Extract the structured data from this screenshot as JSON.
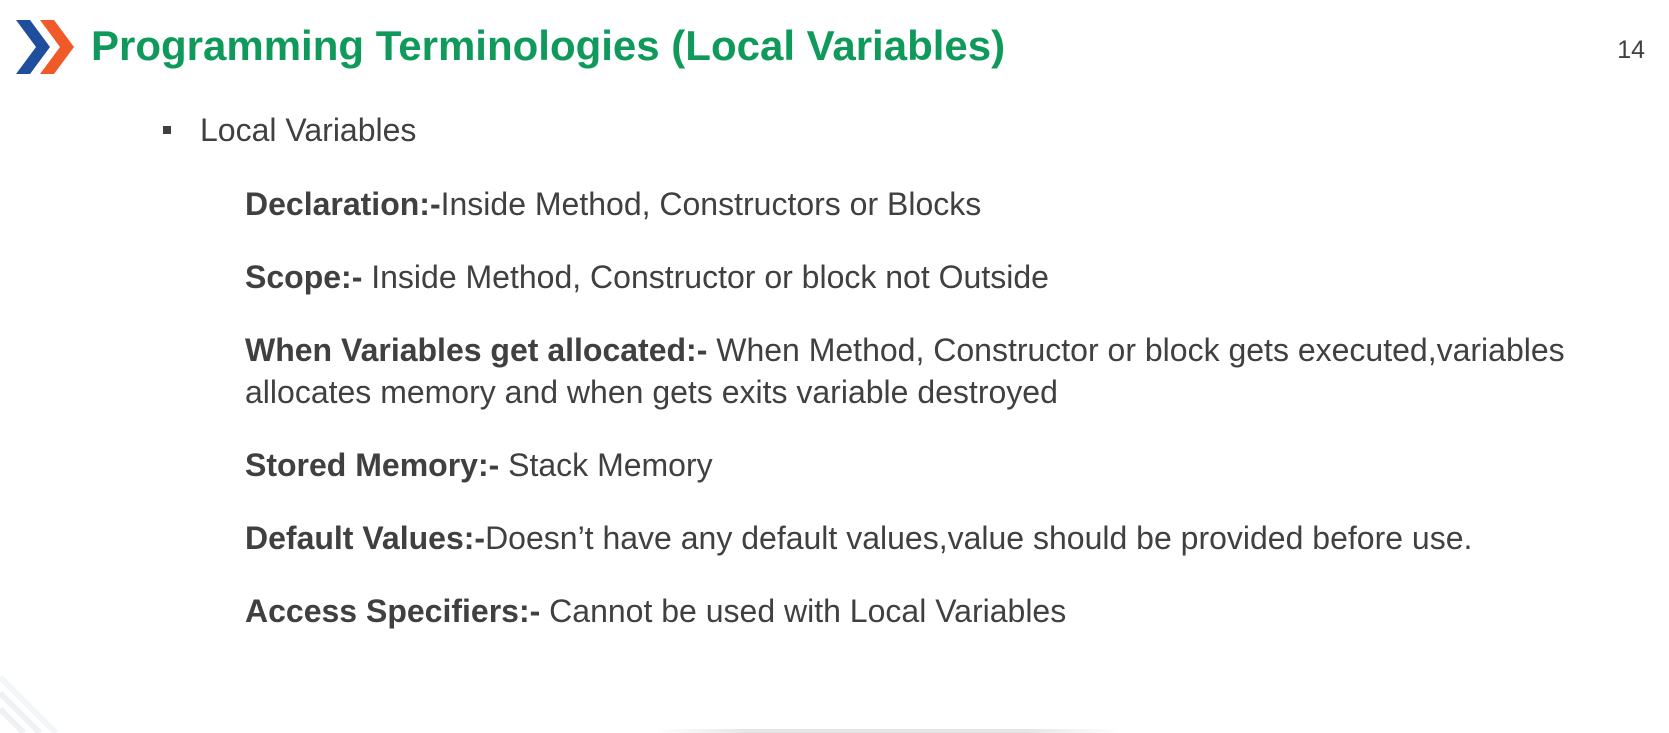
{
  "slide": {
    "title": "Programming Terminologies (Local Variables)",
    "page_number": "14",
    "accent_color": "#0f9a5b"
  },
  "logo": {
    "icon": "double-chevron-logo-icon",
    "colors": [
      "#1f4e9c",
      "#f05a28"
    ]
  },
  "bullet": {
    "text": "Local Variables"
  },
  "details": [
    {
      "label": "Declaration:-",
      "text": "Inside Method, Constructors or Blocks"
    },
    {
      "label": "Scope:-",
      "text": " Inside Method, Constructor or block not Outside"
    },
    {
      "label": "When Variables get allocated:-",
      "text": " When Method, Constructor or block gets executed,variables allocates memory and when gets exits variable destroyed"
    },
    {
      "label": "Stored Memory:-",
      "text": " Stack Memory"
    },
    {
      "label": "Default Values:-",
      "text": "Doesn’t have any default values,value should be provided before use."
    },
    {
      "label": "Access Specifiers:-",
      "text": " Cannot be used with Local Variables"
    }
  ]
}
